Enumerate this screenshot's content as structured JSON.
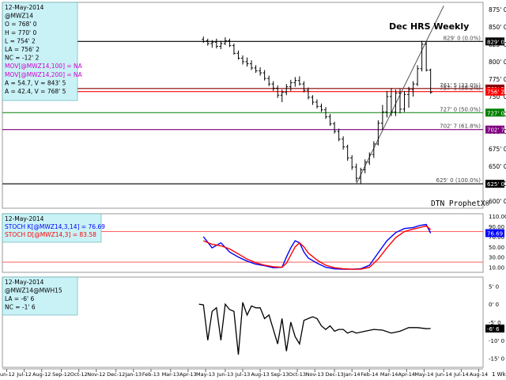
{
  "chart_data": [
    {
      "type": "ohlc",
      "title": "Dec HRS Weekly",
      "watermark": "DTN ProphetX®",
      "info_box": [
        "12-May-2014",
        "@MWZ14",
        "O = 768' 0",
        "H = 770' 0",
        "L = 754' 2",
        "LA = 756' 2",
        "NC = -12' 2",
        "MOV[@MWZ14,100] = NA",
        "MOV[@MWZ14,200] = NA",
        "A = 54.7, V = 843' 5",
        "A = 42.4, V = 768' 5"
      ],
      "y_ticks": [
        "875' 0",
        "850' 0",
        "825' 0",
        "800' 0",
        "775' 0",
        "750' 0",
        "725' 0",
        "700' 0",
        "675' 0",
        "650' 0",
        "625' 0",
        "600' 0"
      ],
      "ylim": [
        590,
        885
      ],
      "fib_levels": [
        {
          "price": 829,
          "label": "829' 0 (0.0%)",
          "axis": "829' 0",
          "color": "#000000"
        },
        {
          "price": 761.5,
          "label": "761' 5 (33.0%)",
          "axis": "761' 5",
          "color": "#8b0000"
        },
        {
          "price": 757.1,
          "label": "757' 1 (38.2%)",
          "axis": "756' 2",
          "color": "#ff0000"
        },
        {
          "price": 727,
          "label": "727' 0 (50.0%)",
          "axis": "727' 0",
          "color": "#008000"
        },
        {
          "price": 702.7,
          "label": "702' 7 (61.8%)",
          "axis": "702' 7",
          "color": "#800080"
        },
        {
          "price": 625,
          "label": "625' 0 (100.0%)",
          "axis": "625' 0",
          "color": "#000000"
        }
      ],
      "trendline": [
        [
          2014.02,
          625
        ],
        [
          2014.42,
          880
        ]
      ],
      "bars": [
        {
          "t": 2013.32,
          "o": 832,
          "h": 836,
          "l": 827,
          "c": 829
        },
        {
          "t": 2013.34,
          "o": 830,
          "h": 833,
          "l": 823,
          "c": 826
        },
        {
          "t": 2013.36,
          "o": 826,
          "h": 831,
          "l": 820,
          "c": 828
        },
        {
          "t": 2013.38,
          "o": 828,
          "h": 833,
          "l": 819,
          "c": 822
        },
        {
          "t": 2013.4,
          "o": 822,
          "h": 830,
          "l": 818,
          "c": 826
        },
        {
          "t": 2013.42,
          "o": 826,
          "h": 835,
          "l": 824,
          "c": 830
        },
        {
          "t": 2013.44,
          "o": 830,
          "h": 833,
          "l": 821,
          "c": 823
        },
        {
          "t": 2013.46,
          "o": 823,
          "h": 826,
          "l": 810,
          "c": 812
        },
        {
          "t": 2013.48,
          "o": 812,
          "h": 816,
          "l": 803,
          "c": 805
        },
        {
          "t": 2013.5,
          "o": 805,
          "h": 809,
          "l": 796,
          "c": 800
        },
        {
          "t": 2013.52,
          "o": 800,
          "h": 806,
          "l": 793,
          "c": 797
        },
        {
          "t": 2013.54,
          "o": 797,
          "h": 802,
          "l": 788,
          "c": 791
        },
        {
          "t": 2013.56,
          "o": 791,
          "h": 795,
          "l": 784,
          "c": 787
        },
        {
          "t": 2013.58,
          "o": 787,
          "h": 792,
          "l": 780,
          "c": 784
        },
        {
          "t": 2013.6,
          "o": 784,
          "h": 788,
          "l": 773,
          "c": 776
        },
        {
          "t": 2013.62,
          "o": 776,
          "h": 780,
          "l": 765,
          "c": 768
        },
        {
          "t": 2013.64,
          "o": 768,
          "h": 772,
          "l": 758,
          "c": 762
        },
        {
          "t": 2013.66,
          "o": 762,
          "h": 766,
          "l": 748,
          "c": 752
        },
        {
          "t": 2013.68,
          "o": 752,
          "h": 760,
          "l": 742,
          "c": 756
        },
        {
          "t": 2013.7,
          "o": 756,
          "h": 768,
          "l": 752,
          "c": 764
        },
        {
          "t": 2013.72,
          "o": 764,
          "h": 774,
          "l": 758,
          "c": 770
        },
        {
          "t": 2013.74,
          "o": 770,
          "h": 778,
          "l": 764,
          "c": 773
        },
        {
          "t": 2013.76,
          "o": 773,
          "h": 779,
          "l": 766,
          "c": 768
        },
        {
          "t": 2013.78,
          "o": 768,
          "h": 772,
          "l": 756,
          "c": 759
        },
        {
          "t": 2013.8,
          "o": 759,
          "h": 763,
          "l": 746,
          "c": 749
        },
        {
          "t": 2013.82,
          "o": 749,
          "h": 752,
          "l": 738,
          "c": 742
        },
        {
          "t": 2013.84,
          "o": 742,
          "h": 746,
          "l": 733,
          "c": 736
        },
        {
          "t": 2013.86,
          "o": 736,
          "h": 740,
          "l": 728,
          "c": 731
        },
        {
          "t": 2013.88,
          "o": 731,
          "h": 735,
          "l": 718,
          "c": 721
        },
        {
          "t": 2013.9,
          "o": 721,
          "h": 725,
          "l": 708,
          "c": 711
        },
        {
          "t": 2013.92,
          "o": 711,
          "h": 714,
          "l": 697,
          "c": 700
        },
        {
          "t": 2013.94,
          "o": 700,
          "h": 704,
          "l": 686,
          "c": 689
        },
        {
          "t": 2013.96,
          "o": 689,
          "h": 693,
          "l": 674,
          "c": 678
        },
        {
          "t": 2013.98,
          "o": 678,
          "h": 681,
          "l": 658,
          "c": 662
        },
        {
          "t": 2014.0,
          "o": 662,
          "h": 666,
          "l": 645,
          "c": 649
        },
        {
          "t": 2014.02,
          "o": 649,
          "h": 654,
          "l": 628,
          "c": 633
        },
        {
          "t": 2014.04,
          "o": 633,
          "h": 648,
          "l": 625,
          "c": 645
        },
        {
          "t": 2014.06,
          "o": 645,
          "h": 660,
          "l": 640,
          "c": 656
        },
        {
          "t": 2014.08,
          "o": 656,
          "h": 670,
          "l": 652,
          "c": 667
        },
        {
          "t": 2014.1,
          "o": 667,
          "h": 686,
          "l": 662,
          "c": 682
        },
        {
          "t": 2014.12,
          "o": 682,
          "h": 716,
          "l": 680,
          "c": 712
        },
        {
          "t": 2014.14,
          "o": 712,
          "h": 738,
          "l": 702,
          "c": 728
        },
        {
          "t": 2014.16,
          "o": 728,
          "h": 758,
          "l": 720,
          "c": 750
        },
        {
          "t": 2014.18,
          "o": 750,
          "h": 762,
          "l": 722,
          "c": 728
        },
        {
          "t": 2014.2,
          "o": 728,
          "h": 760,
          "l": 722,
          "c": 755
        },
        {
          "t": 2014.22,
          "o": 755,
          "h": 761,
          "l": 726,
          "c": 732
        },
        {
          "t": 2014.24,
          "o": 732,
          "h": 758,
          "l": 728,
          "c": 753
        },
        {
          "t": 2014.26,
          "o": 753,
          "h": 764,
          "l": 734,
          "c": 760
        },
        {
          "t": 2014.28,
          "o": 760,
          "h": 772,
          "l": 750,
          "c": 768
        },
        {
          "t": 2014.3,
          "o": 768,
          "h": 795,
          "l": 765,
          "c": 790
        },
        {
          "t": 2014.32,
          "o": 790,
          "h": 830,
          "l": 786,
          "c": 825
        },
        {
          "t": 2014.34,
          "o": 825,
          "h": 829,
          "l": 786,
          "c": 788
        },
        {
          "t": 2014.36,
          "o": 788,
          "h": 790,
          "l": 754,
          "c": 756
        }
      ]
    },
    {
      "type": "line",
      "title": "STOCH",
      "info_box": [
        "12-May-2014",
        "STOCH K[@MWZ14,3,14] = 76.69",
        "STOCH D[@MWZ14,3] = 83.58"
      ],
      "y_ticks": [
        "110.00",
        "90.00",
        "70.00",
        "50.00",
        "30.00",
        "10.00"
      ],
      "axis_label": "76.69",
      "ylim": [
        0,
        115
      ],
      "ref_lines": [
        80,
        20
      ],
      "series": [
        {
          "name": "STOCH K[@MWZ14,3,14]",
          "color": "#0000ff",
          "points": [
            [
              2013.32,
              70
            ],
            [
              2013.36,
              48
            ],
            [
              2013.4,
              58
            ],
            [
              2013.44,
              40
            ],
            [
              2013.48,
              30
            ],
            [
              2013.52,
              22
            ],
            [
              2013.56,
              16
            ],
            [
              2013.6,
              13
            ],
            [
              2013.64,
              9
            ],
            [
              2013.68,
              10
            ],
            [
              2013.7,
              30
            ],
            [
              2013.72,
              48
            ],
            [
              2013.74,
              62
            ],
            [
              2013.76,
              58
            ],
            [
              2013.78,
              40
            ],
            [
              2013.8,
              28
            ],
            [
              2013.84,
              18
            ],
            [
              2013.88,
              10
            ],
            [
              2013.92,
              7
            ],
            [
              2013.96,
              6
            ],
            [
              2014.0,
              6
            ],
            [
              2014.04,
              7
            ],
            [
              2014.08,
              14
            ],
            [
              2014.12,
              38
            ],
            [
              2014.16,
              62
            ],
            [
              2014.2,
              78
            ],
            [
              2014.24,
              86
            ],
            [
              2014.28,
              88
            ],
            [
              2014.31,
              92
            ],
            [
              2014.34,
              94
            ],
            [
              2014.36,
              77
            ]
          ]
        },
        {
          "name": "STOCH D[@MWZ14,3]",
          "color": "#ff0000",
          "points": [
            [
              2013.32,
              62
            ],
            [
              2013.36,
              55
            ],
            [
              2013.4,
              52
            ],
            [
              2013.44,
              46
            ],
            [
              2013.48,
              36
            ],
            [
              2013.52,
              26
            ],
            [
              2013.56,
              19
            ],
            [
              2013.6,
              14
            ],
            [
              2013.64,
              11
            ],
            [
              2013.68,
              10
            ],
            [
              2013.7,
              18
            ],
            [
              2013.72,
              34
            ],
            [
              2013.74,
              50
            ],
            [
              2013.76,
              58
            ],
            [
              2013.78,
              50
            ],
            [
              2013.8,
              38
            ],
            [
              2013.84,
              24
            ],
            [
              2013.88,
              14
            ],
            [
              2013.92,
              9
            ],
            [
              2013.96,
              7
            ],
            [
              2014.0,
              6
            ],
            [
              2014.04,
              6
            ],
            [
              2014.08,
              10
            ],
            [
              2014.12,
              26
            ],
            [
              2014.16,
              48
            ],
            [
              2014.2,
              68
            ],
            [
              2014.24,
              80
            ],
            [
              2014.28,
              85
            ],
            [
              2014.31,
              88
            ],
            [
              2014.34,
              91
            ],
            [
              2014.36,
              84
            ]
          ]
        }
      ]
    },
    {
      "type": "line",
      "title": "@MWZ14@MWH15 spread",
      "info_box": [
        "12-May-2014",
        "@MWZ14@MWH15",
        "LA = -6' 6",
        "NC = -1' 6"
      ],
      "y_ticks": [
        "5' 0",
        "0' 0",
        "-5' 0",
        "-10' 0",
        "-15' 0"
      ],
      "axis_label": "-6' 6",
      "ylim": [
        -17.5,
        7.5
      ],
      "series": [
        {
          "name": "@MWZ14@MWH15",
          "color": "#000000",
          "points": [
            [
              2013.3,
              0
            ],
            [
              2013.32,
              -0.2
            ],
            [
              2013.34,
              -10
            ],
            [
              2013.36,
              -2
            ],
            [
              2013.38,
              -1
            ],
            [
              2013.4,
              -10
            ],
            [
              2013.42,
              0
            ],
            [
              2013.44,
              -1.5
            ],
            [
              2013.46,
              -2
            ],
            [
              2013.48,
              -14
            ],
            [
              2013.5,
              0.5
            ],
            [
              2013.52,
              -3
            ],
            [
              2013.54,
              -0.5
            ],
            [
              2013.56,
              -1
            ],
            [
              2013.58,
              -1
            ],
            [
              2013.6,
              -4
            ],
            [
              2013.62,
              -3
            ],
            [
              2013.64,
              -7
            ],
            [
              2013.66,
              -11
            ],
            [
              2013.68,
              -4
            ],
            [
              2013.7,
              -13
            ],
            [
              2013.72,
              -5
            ],
            [
              2013.74,
              -9
            ],
            [
              2013.76,
              -11
            ],
            [
              2013.78,
              -4.5
            ],
            [
              2013.8,
              -4
            ],
            [
              2013.82,
              -3.5
            ],
            [
              2013.84,
              -4
            ],
            [
              2013.86,
              -6
            ],
            [
              2013.88,
              -7
            ],
            [
              2013.9,
              -6
            ],
            [
              2013.92,
              -7.5
            ],
            [
              2013.94,
              -7
            ],
            [
              2013.96,
              -7
            ],
            [
              2013.98,
              -8
            ],
            [
              2014.0,
              -7.5
            ],
            [
              2014.02,
              -8
            ],
            [
              2014.06,
              -7.5
            ],
            [
              2014.1,
              -7
            ],
            [
              2014.14,
              -7.2
            ],
            [
              2014.18,
              -8
            ],
            [
              2014.22,
              -7.5
            ],
            [
              2014.26,
              -6.5
            ],
            [
              2014.3,
              -6.5
            ],
            [
              2014.34,
              -6.8
            ],
            [
              2014.36,
              -6.75
            ]
          ]
        }
      ]
    }
  ],
  "x_axis": {
    "tick_labels": [
      "Jun-12",
      "Jul-12",
      "Aug-12",
      "Sep-12",
      "Oct-12",
      "Nov-12",
      "Dec-12",
      "Jan-13",
      "Feb-13",
      "Mar-13",
      "Apr-13",
      "May-13",
      "Jun-13",
      "Jul-13",
      "Aug-13",
      "Sep-13",
      "Oct-13",
      "Nov-13",
      "Dec-13",
      "Jan-14",
      "Feb-14",
      "Mar-14",
      "Apr-14",
      "May-14",
      "Jun-14",
      "Jul-14",
      "Aug-14"
    ],
    "tick_values": [
      2012.42,
      2012.5,
      2012.58,
      2012.67,
      2012.75,
      2012.83,
      2012.92,
      2013.0,
      2013.08,
      2013.17,
      2013.25,
      2013.33,
      2013.42,
      2013.5,
      2013.58,
      2013.67,
      2013.75,
      2013.83,
      2013.92,
      2014.0,
      2014.08,
      2014.17,
      2014.25,
      2014.33,
      2014.42,
      2014.5,
      2014.58
    ],
    "range": [
      2012.4,
      2014.6
    ],
    "corner_label": "1 Wk"
  }
}
